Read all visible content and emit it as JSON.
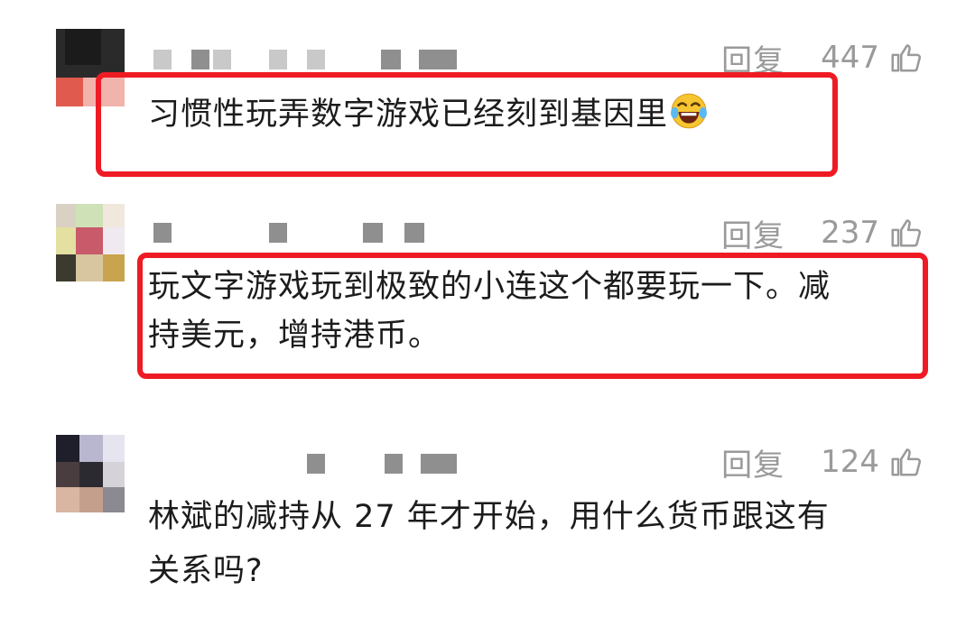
{
  "comments": [
    {
      "reply_label": "回复",
      "likes": "447",
      "text": "习惯性玩弄数字游戏已经刻到基因里",
      "emoji": "laughing-tears-emoji",
      "highlighted": true
    },
    {
      "reply_label": "回复",
      "likes": "237",
      "text_line1": "玩文字游戏玩到极致的小连这个都要玩一下。减",
      "text_line2": "持美元，增持港币。",
      "highlighted": true
    },
    {
      "reply_label": "回复",
      "likes": "124",
      "text_line1": "林斌的减持从 27 年才开始，用什么货币跟这有",
      "text_line2": "关系吗?",
      "highlighted": false
    }
  ],
  "colors": {
    "highlight_border": "#ef1b24",
    "meta_text": "#9a9a9a",
    "body_text": "#1c1c1c"
  },
  "icons": {
    "like": "thumbs-up-icon"
  }
}
